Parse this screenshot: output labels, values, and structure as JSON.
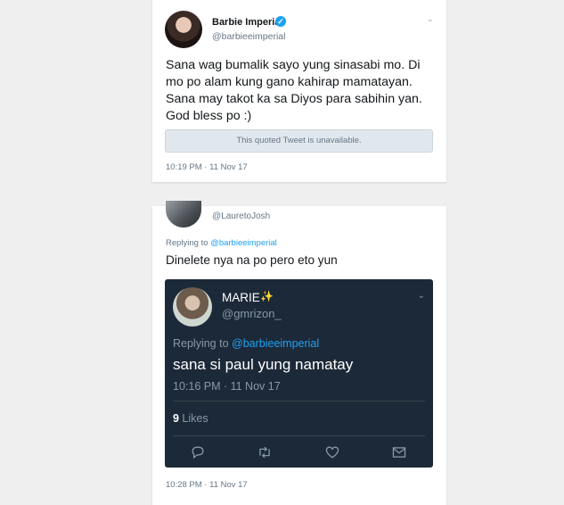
{
  "tweet1": {
    "name": "Barbie Imperial",
    "handle": "@barbieeimperial",
    "text": "Sana wag bumalik sayo yung sinasabi mo. Di mo po alam kung gano kahirap mamatayan. Sana may takot ka sa Diyos para sabihin yan. God bless po :)",
    "quoted_unavailable": "This quoted Tweet is unavailable.",
    "timestamp": "10:19 PM · 11 Nov 17"
  },
  "tweet2": {
    "handle": "@LauretoJosh",
    "replying_prefix": "Replying to ",
    "replying_to": "@barbieeimperial",
    "text": "Dinelete nya na po pero eto yun",
    "timestamp": "10:28 PM · 11 Nov 17"
  },
  "embedded": {
    "name": "MARIE",
    "name_emoji": "✨",
    "handle": "@gmrizon_",
    "replying_prefix": "Replying to ",
    "replying_to": "@barbieeimperial",
    "text": "sana si paul yung namatay",
    "timestamp": "10:16 PM · 11 Nov 17",
    "likes_count": "9",
    "likes_label": " Likes",
    "actions": [
      "reply-icon",
      "retweet-icon",
      "heart-icon",
      "mail-icon"
    ]
  },
  "colors": {
    "link": "#1da1f2",
    "embed_bg": "#1c2938",
    "muted": "#657786"
  }
}
